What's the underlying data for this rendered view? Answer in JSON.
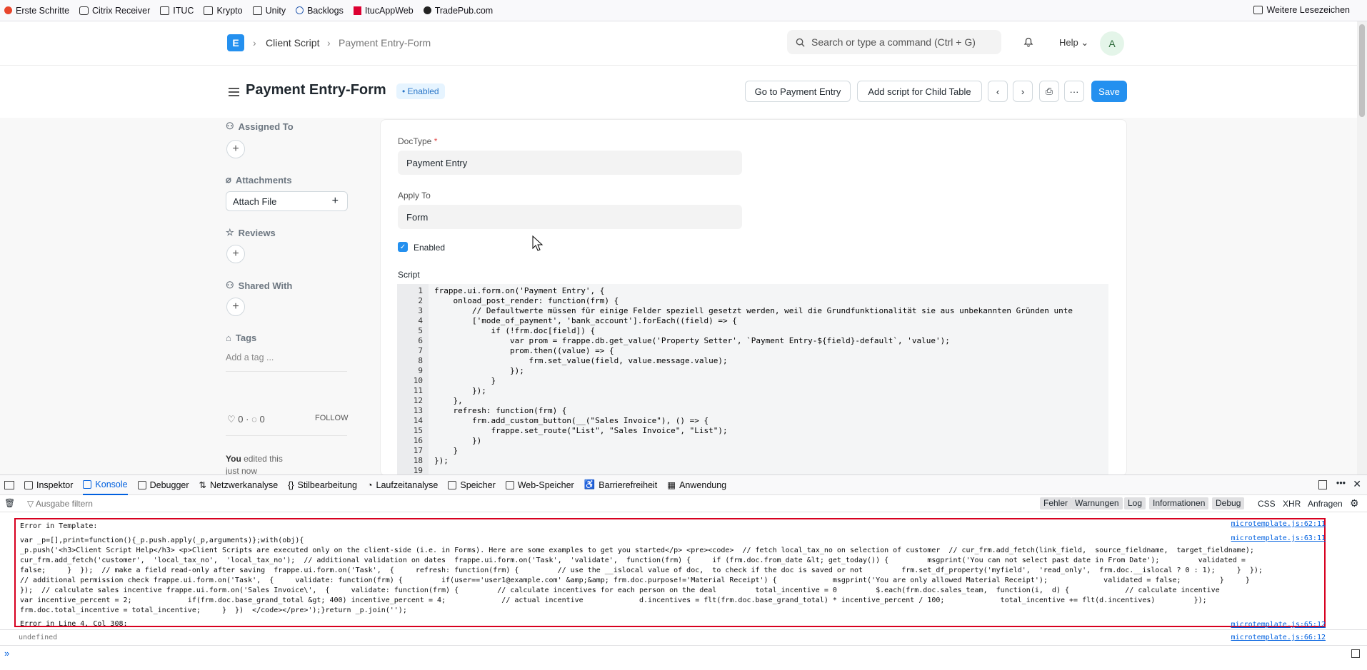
{
  "bookmarks": {
    "items": [
      "Erste Schritte",
      "Citrix Receiver",
      "ITUC",
      "Krypto",
      "Unity",
      "Backlogs",
      "ItucAppWeb",
      "TradePub.com"
    ],
    "other": "Weitere Lesezeichen"
  },
  "navbar": {
    "breadcrumb": [
      "Client Script",
      "Payment Entry-Form"
    ],
    "search_placeholder": "Search or type a command (Ctrl + G)",
    "help": "Help",
    "avatar": "A"
  },
  "page": {
    "title": "Payment Entry-Form",
    "status": "Enabled",
    "buttons": {
      "goto": "Go to Payment Entry",
      "child": "Add script for Child Table",
      "save": "Save"
    }
  },
  "sidebar": {
    "assigned": "Assigned To",
    "attachments": "Attachments",
    "attach_file": "Attach File",
    "reviews": "Reviews",
    "shared": "Shared With",
    "tags": "Tags",
    "add_tag": "Add a tag ...",
    "likes": "0",
    "comments": "0",
    "follow": "FOLLOW",
    "edited_by": "You",
    "edited_text": "edited this",
    "edited_time": "just now"
  },
  "form": {
    "doctype_label": "DocType",
    "doctype_value": "Payment Entry",
    "apply_label": "Apply To",
    "apply_value": "Form",
    "enabled_label": "Enabled",
    "script_label": "Script"
  },
  "code_lines": [
    "frappe.ui.form.on('Payment Entry', {",
    "    onload_post_render: function(frm) {",
    "        // Defaultwerte müssen für einige Felder speziell gesetzt werden, weil die Grundfunktionalität sie aus unbekannten Gründen unte",
    "        ['mode_of_payment', 'bank_account'].forEach((field) => {",
    "            if (!frm.doc[field]) {",
    "                var prom = frappe.db.get_value('Property Setter', `Payment Entry-${field}-default`, 'value');",
    "                prom.then((value) => {",
    "                    frm.set_value(field, value.message.value);",
    "                });",
    "            }",
    "        });",
    "    },",
    "    refresh: function(frm) {",
    "        frm.add_custom_button(__(\"Sales Invoice\"), () => {",
    "            frappe.set_route(\"List\", \"Sales Invoice\", \"List\");",
    "        })",
    "    }",
    "});",
    ""
  ],
  "devtools": {
    "tabs": [
      "Inspektor",
      "Konsole",
      "Debugger",
      "Netzwerkanalyse",
      "Stilbearbeitung",
      "Laufzeitanalyse",
      "Speicher",
      "Web-Speicher",
      "Barrierefreiheit",
      "Anwendung"
    ],
    "filter_placeholder": "Ausgabe filtern",
    "levels": [
      "Fehler",
      "Warnungen",
      "Log",
      "Informationen",
      "Debug"
    ],
    "types": [
      "CSS",
      "XHR",
      "Anfragen"
    ],
    "error_title": "Error in Template:",
    "error_lines": [
      "var _p=[],print=function(){_p.push.apply(_p,arguments)};with(obj){",
      "_p.push('<h3>Client Script Help</h3> <p>Client Scripts are executed only on the client-side (i.e. in Forms). Here are some examples to get you started</p> <pre><code>  // fetch local_tax_no on selection of customer  // cur_frm.add_fetch(link_field,  source_fieldname,  target_fieldname);",
      "cur_frm.add_fetch('customer',  'local_tax_no',  'local_tax_no');  // additional validation on dates  frappe.ui.form.on('Task',  'validate',  function(frm) {     if (frm.doc.from_date &lt; get_today()) {         msgprint('You can not select past date in From Date');         validated =",
      "false;     }  });  // make a field read-only after saving  frappe.ui.form.on('Task',  {     refresh: function(frm) {         // use the __islocal value of doc,  to check if the doc is saved or not         frm.set_df_property('myfield',  'read_only',  frm.doc.__islocal ? 0 : 1);     }  });",
      "// additional permission check frappe.ui.form.on('Task',  {     validate: function(frm) {         if(user=='user1@example.com' &amp;&amp; frm.doc.purpose!='Material Receipt') {             msgprint('You are only allowed Material Receipt');             validated = false;         }     }",
      "});  // calculate sales incentive frappe.ui.form.on('Sales Invoice\\',  {     validate: function(frm) {         // calculate incentives for each person on the deal         total_incentive = 0         $.each(frm.doc.sales_team,  function(i,  d) {             // calculate incentive",
      "var incentive_percent = 2;             if(frm.doc.base_grand_total &gt; 400) incentive_percent = 4;             // actual incentive             d.incentives = flt(frm.doc.base_grand_total) * incentive_percent / 100;             total_incentive += flt(d.incentives)         });",
      "frm.doc.total_incentive = total_incentive;     }  })  </code></pre>');}return _p.join('');"
    ],
    "error_next": "Error in Line 4, Col 308:",
    "undefined": "undefined",
    "sources": [
      "microtemplate.js:62:11",
      "microtemplate.js:63:11",
      "microtemplate.js:65:12",
      "microtemplate.js:66:12"
    ]
  }
}
